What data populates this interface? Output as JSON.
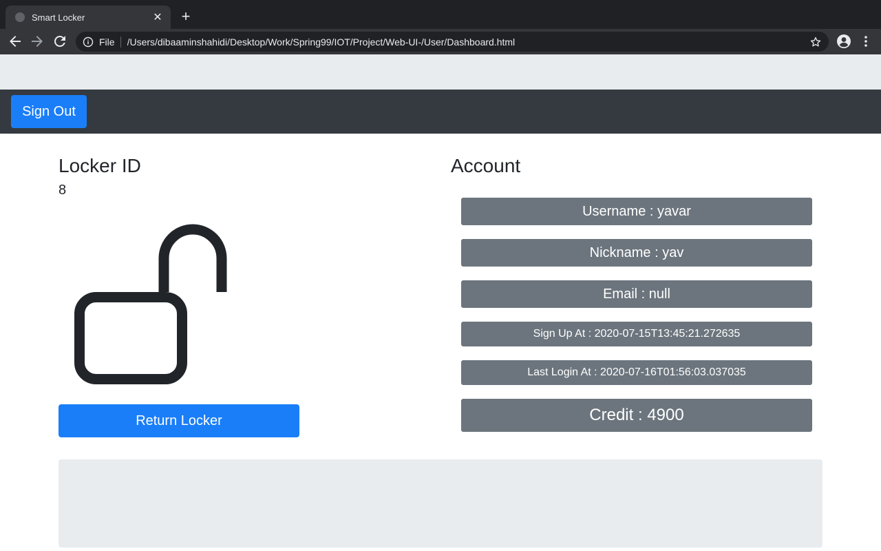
{
  "browser": {
    "tab_title": "Smart Locker",
    "tab_close": "✕",
    "new_tab": "+",
    "address_scheme": "File",
    "address_url": "/Users/dibaaminshahidi/Desktop/Work/Spring99/IOT/Project/Web-UI-/User/Dashboard.html",
    "icons": [
      "back-arrow-icon",
      "forward-arrow-icon",
      "reload-icon",
      "info-icon",
      "star-icon",
      "profile-icon",
      "kebab-menu-icon"
    ]
  },
  "navbar": {
    "sign_out_label": "Sign Out"
  },
  "locker": {
    "heading": "Locker ID",
    "id_value": "8",
    "status_icon": "unlocked-padlock-icon",
    "return_label": "Return Locker"
  },
  "account": {
    "heading": "Account",
    "username": "Username : yavar",
    "nickname": "Nickname : yav",
    "email": "Email : null",
    "sign_up_at": "Sign Up At : 2020-07-15T13:45:21.272635",
    "last_login_at": "Last Login At : 2020-07-16T01:56:03.037035",
    "credit": "Credit : 4900"
  },
  "colors": {
    "primary": "#1a7ef8",
    "navbar_dark": "#343a40",
    "secondary": "#6c757d",
    "light_gray": "#e9ecef"
  }
}
